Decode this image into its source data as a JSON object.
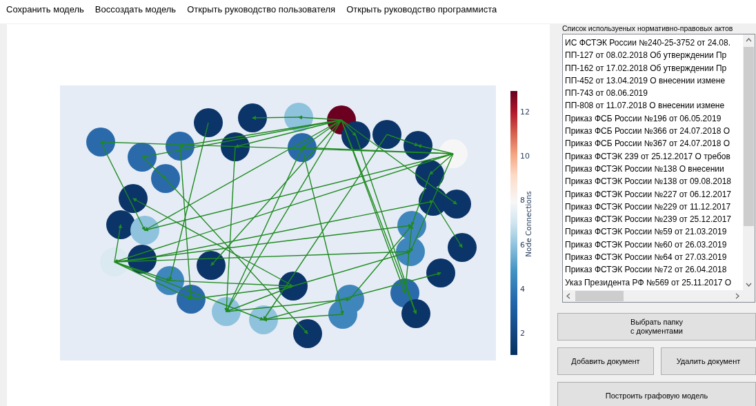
{
  "menu": [
    "Сохранить модель",
    "Воссоздать модель",
    "Открыть руководство пользователя",
    "Открыть руководство программиста"
  ],
  "graph": {
    "colorbar": {
      "title": "Node Connections",
      "ticks": [
        "12",
        "10",
        "8",
        "6",
        "4",
        "2"
      ]
    }
  },
  "documents": {
    "title": "Список используеных нормативно-правовых актов",
    "items": [
      "ИС ФСТЭК России №240-25-3752 от 24.08.",
      "ПП-127 от 08.02.2018 Об утверждении Пр",
      "ПП-162 от 17.02.2018 Об утверждении Пр",
      "ПП-452 от 13.04.2019 О внесении измене",
      "ПП-743 от 08.06.2019",
      "ПП-808 от 11.07.2018 О внесении измене",
      "Приказ ФСБ России №196 от 06.05.2019",
      "Приказ ФСБ России №366 от 24.07.2018 О",
      "Приказ ФСБ России №367 от 24.07.2018 О",
      "Приказ ФСТЭК 239 от 25.12.2017 О требов",
      "Приказ ФСТЭК России №138 О внесении",
      "Приказ ФСТЭК России №138 от 09.08.2018",
      "Приказ ФСТЭК России №227 от 06.12.2017",
      "Приказ ФСТЭК России №229 от 11.12.2017",
      "Приказ ФСТЭК России №239 от 25.12.2017",
      "Приказ ФСТЭК России №59 от 21.03.2019",
      "Приказ ФСТЭК России №60 от 26.03.2019",
      "Приказ ФСТЭК России №64 от 27.03.2019",
      "Приказ ФСТЭК России №72 от 26.04.2018",
      "Указ Президента РФ №569 от 25.11.2017 О"
    ]
  },
  "buttons": [
    {
      "label": "Выбрать папку\nс документами",
      "kind": "wide"
    },
    {
      "label": "Добавить документ",
      "kind": "half"
    },
    {
      "label": "Удалить документ",
      "kind": "half"
    },
    {
      "label": "Построить графовую модель",
      "kind": "wide"
    }
  ]
}
